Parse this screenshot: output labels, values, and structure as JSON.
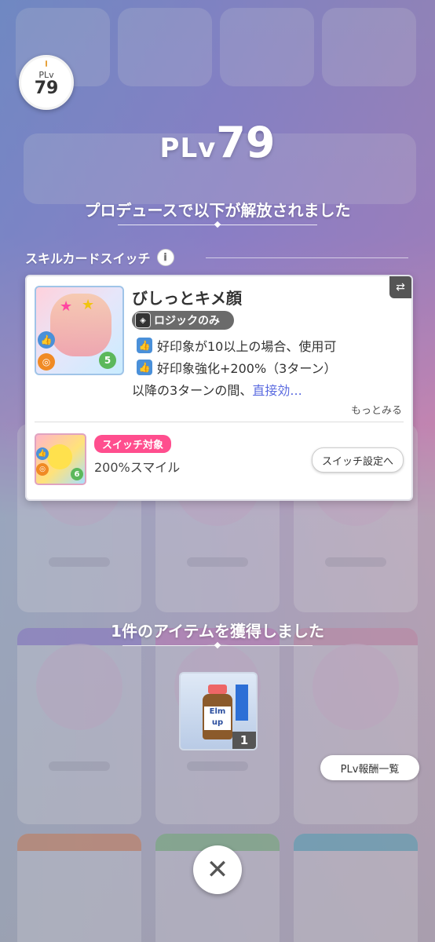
{
  "player_level": {
    "badge_label": "PLv",
    "badge_value": "79",
    "big_prefix": "PLv",
    "big_value": "79"
  },
  "unlock_headline": "プロデュースで以下が解放されました",
  "section": {
    "label": "スキルカードスイッチ",
    "info_icon": "i"
  },
  "skill_card": {
    "name": "びしっとキメ顔",
    "tag": "ロジックのみ",
    "cost": "5",
    "effects": [
      "好印象が10以上の場合、使用可",
      "好印象強化+200%（3ターン）"
    ],
    "continuation_prefix": "以降の3ターンの間、",
    "continuation_link": "直接効...",
    "see_more": "もっとみる",
    "switch_corner_icon": "switch-icon"
  },
  "switch_target": {
    "tag": "スイッチ対象",
    "name": "200%スマイル",
    "cost": "6",
    "settings_button": "スイッチ設定へ"
  },
  "item_headline": "1件のアイテムを獲得しました",
  "item": {
    "quantity": "1",
    "label_text": "Elm up"
  },
  "reward_list_button": "PLv報酬一覧",
  "close_icon": "✕"
}
